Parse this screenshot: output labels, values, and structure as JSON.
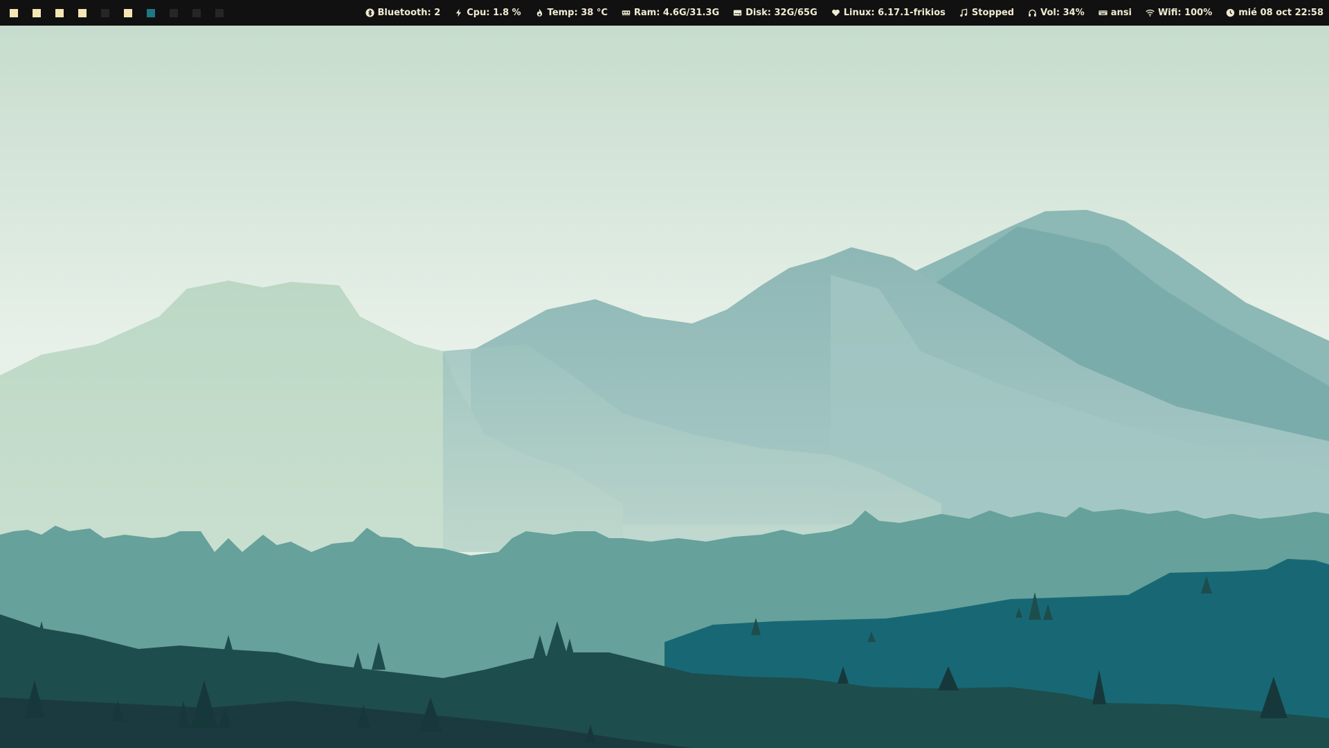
{
  "topbar": {
    "workspaces": [
      {
        "id": "1",
        "state": "occupied"
      },
      {
        "id": "2",
        "state": "occupied"
      },
      {
        "id": "3",
        "state": "occupied"
      },
      {
        "id": "4",
        "state": "occupied"
      },
      {
        "id": "5",
        "state": "empty"
      },
      {
        "id": "6",
        "state": "occupied"
      },
      {
        "id": "7",
        "state": "active"
      },
      {
        "id": "8",
        "state": "empty"
      },
      {
        "id": "9",
        "state": "empty"
      },
      {
        "id": "10",
        "state": "empty"
      }
    ],
    "modules": {
      "bluetooth": {
        "icon": "bluetooth-icon",
        "text": "Bluetooth: 2"
      },
      "cpu": {
        "icon": "bolt-icon",
        "text": "Cpu: 1.8 %"
      },
      "temp": {
        "icon": "flame-icon",
        "text": "Temp: 38 °C"
      },
      "ram": {
        "icon": "memory-icon",
        "text": "Ram: 4.6G/31.3G"
      },
      "disk": {
        "icon": "hard-drive-icon",
        "text": "Disk: 32G/65G"
      },
      "kernel": {
        "icon": "heart-icon",
        "text": "Linux: 6.17.1-frikios"
      },
      "music": {
        "icon": "music-note-icon",
        "text": "Stopped"
      },
      "volume": {
        "icon": "headphones-icon",
        "text": "Vol: 34%"
      },
      "keyboard": {
        "icon": "keyboard-icon",
        "text": "ansi"
      },
      "wifi": {
        "icon": "wifi-icon",
        "text": "Wifi: 100%"
      },
      "clock": {
        "icon": "clock-icon",
        "text": "mié 08 oct 22:58"
      }
    }
  },
  "colors": {
    "bar_background": "#111111",
    "bar_text": "#f1ebd2",
    "workspace_occupied": "#f5e6b4",
    "workspace_active": "#1e7785",
    "workspace_empty": "#262626"
  }
}
